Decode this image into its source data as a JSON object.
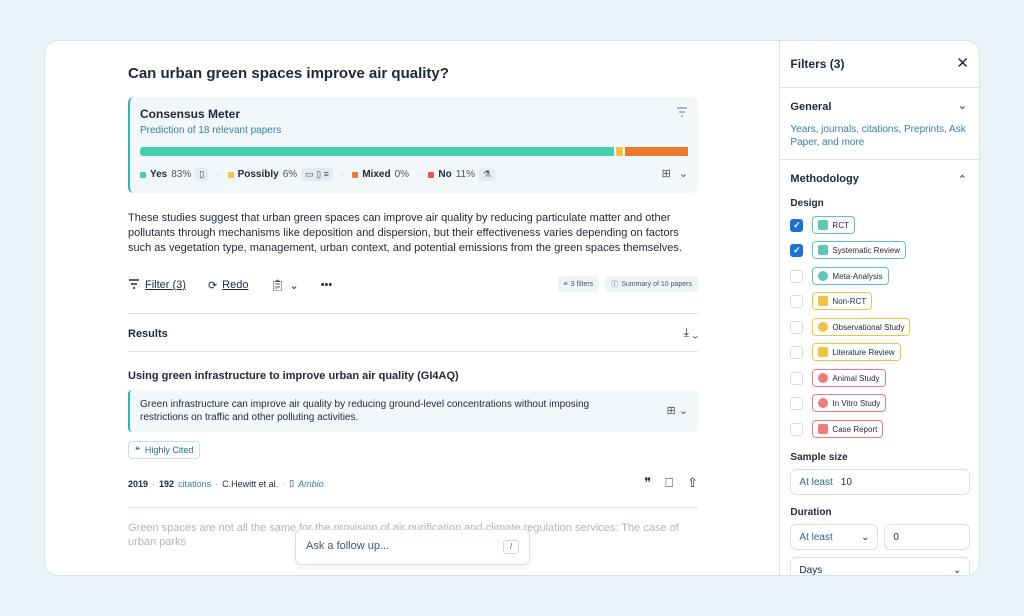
{
  "question": "Can urban green spaces improve air quality?",
  "meter": {
    "title": "Consensus Meter",
    "subtitle": "Prediction of 18 relevant papers",
    "legend": [
      {
        "label": "Yes",
        "pct": "83%",
        "color": "#46cfae",
        "value": 83
      },
      {
        "label": "Possibly",
        "pct": "6%",
        "color": "#f6c343",
        "value": 6
      },
      {
        "label": "Mixed",
        "pct": "0%",
        "color": "#ef7a2d",
        "value": 0
      },
      {
        "label": "No",
        "pct": "11%",
        "color": "#ef5350",
        "value": 11
      }
    ]
  },
  "summary": "These studies suggest that urban green spaces can improve air quality by reducing particulate matter and other pollutants through mechanisms like deposition and dispersion, but their effectiveness varies depending on factors such as vegetation type, management, urban context, and potential emissions from the green spaces themselves.",
  "toolbar": {
    "filter_label": "Filter (3)",
    "redo_label": "Redo",
    "filters_pill": "3 filters",
    "summary_pill": "Summary of 10 papers"
  },
  "results": {
    "title": "Results",
    "paper1": {
      "title": "Using green infrastructure to improve urban air quality (GI4AQ)",
      "summary": "Green infrastructure can improve air quality by reducing ground-level concentrations without imposing restrictions on traffic and other polluting activities.",
      "badge": "Highly Cited",
      "year": "2019",
      "citations_count": "192",
      "citations_word": "citations",
      "authors": "C.Hewitt et al.",
      "journal": "Ambio"
    },
    "paper2_title": "Green spaces are not all the same for the provision of air purification and climate regulation services: The case of urban parks"
  },
  "followup": {
    "placeholder": "Ask a follow up...",
    "shortcut": "/"
  },
  "sidebar": {
    "title": "Filters (3)",
    "general": {
      "title": "General",
      "desc": "Years, journals, citations, Preprints, Ask Paper, and more"
    },
    "methodology": {
      "title": "Methodology"
    },
    "design_label": "Design",
    "design": [
      {
        "label": "RCT",
        "checked": true
      },
      {
        "label": "Systematic Review",
        "checked": true
      },
      {
        "label": "Meta-Analysis",
        "checked": false
      },
      {
        "label": "Non-RCT",
        "checked": false
      },
      {
        "label": "Observational Study",
        "checked": false
      },
      {
        "label": "Literature Review",
        "checked": false
      },
      {
        "label": "Animal Study",
        "checked": false
      },
      {
        "label": "In Vitro Study",
        "checked": false
      },
      {
        "label": "Case Report",
        "checked": false
      }
    ],
    "sample_size": {
      "label": "Sample size",
      "prefix": "At least",
      "value": "10"
    },
    "duration": {
      "label": "Duration",
      "prefix": "At least",
      "value": "0",
      "unit": "Days"
    }
  }
}
